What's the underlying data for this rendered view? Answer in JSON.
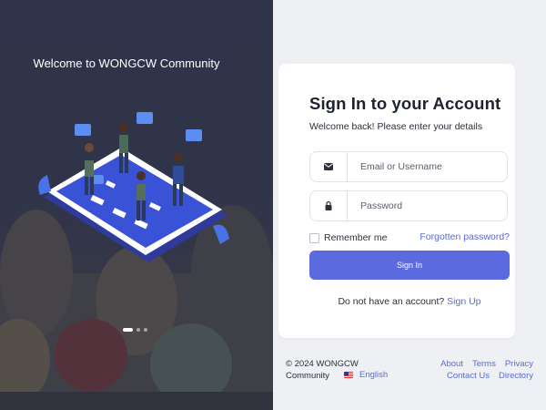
{
  "hero": {
    "welcome": "Welcome to WONGCW Community",
    "carousel": {
      "total": 3,
      "active": 1
    }
  },
  "login": {
    "title": "Sign In to your Account",
    "subtitle": "Welcome back! Please enter your details",
    "username_placeholder": "Email or Username",
    "password_placeholder": "Password",
    "remember_label": "Remember me",
    "forgot_label": "Forgotten password?",
    "submit_label": "Sign In",
    "signup_prompt": "Do not have an account?",
    "signup_link": "Sign Up"
  },
  "footer": {
    "copyright_line1": "© 2024 WONGCW",
    "copyright_line2": "Community",
    "language": "English",
    "links_row1": [
      "About",
      "Terms",
      "Privacy"
    ],
    "links_row2": [
      "Contact Us",
      "Directory"
    ]
  },
  "colors": {
    "accent": "#5b6ade",
    "link": "#5a6bd6",
    "panel_dark": "#3b3f57",
    "page_bg": "#eef0f4"
  },
  "icons": {
    "username_field": "envelope-icon",
    "password_field": "lock-icon"
  }
}
